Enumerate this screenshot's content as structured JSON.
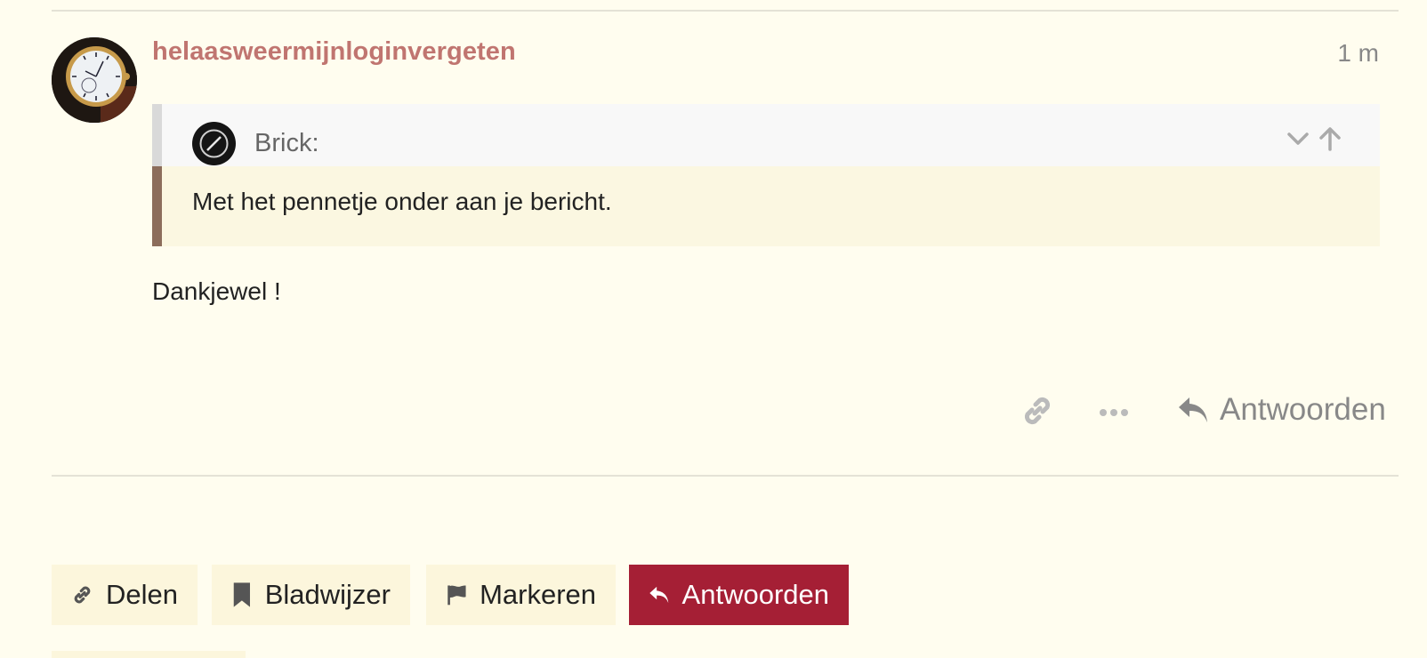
{
  "post": {
    "username": "helaasweermijnloginvergeten",
    "time": "1 m",
    "quote": {
      "author": "Brick:",
      "text": "Met het pennetje onder aan je bericht."
    },
    "body": "Dankjewel !",
    "reply_label": "Antwoorden"
  },
  "footer_buttons": {
    "share": "Delen",
    "bookmark": "Bladwijzer",
    "flag": "Markeren",
    "reply": "Antwoorden"
  },
  "colors": {
    "background": "#fffdef",
    "username": "#c07570",
    "reply_button": "#a51f35",
    "quote_border": "#8c6d5b"
  }
}
